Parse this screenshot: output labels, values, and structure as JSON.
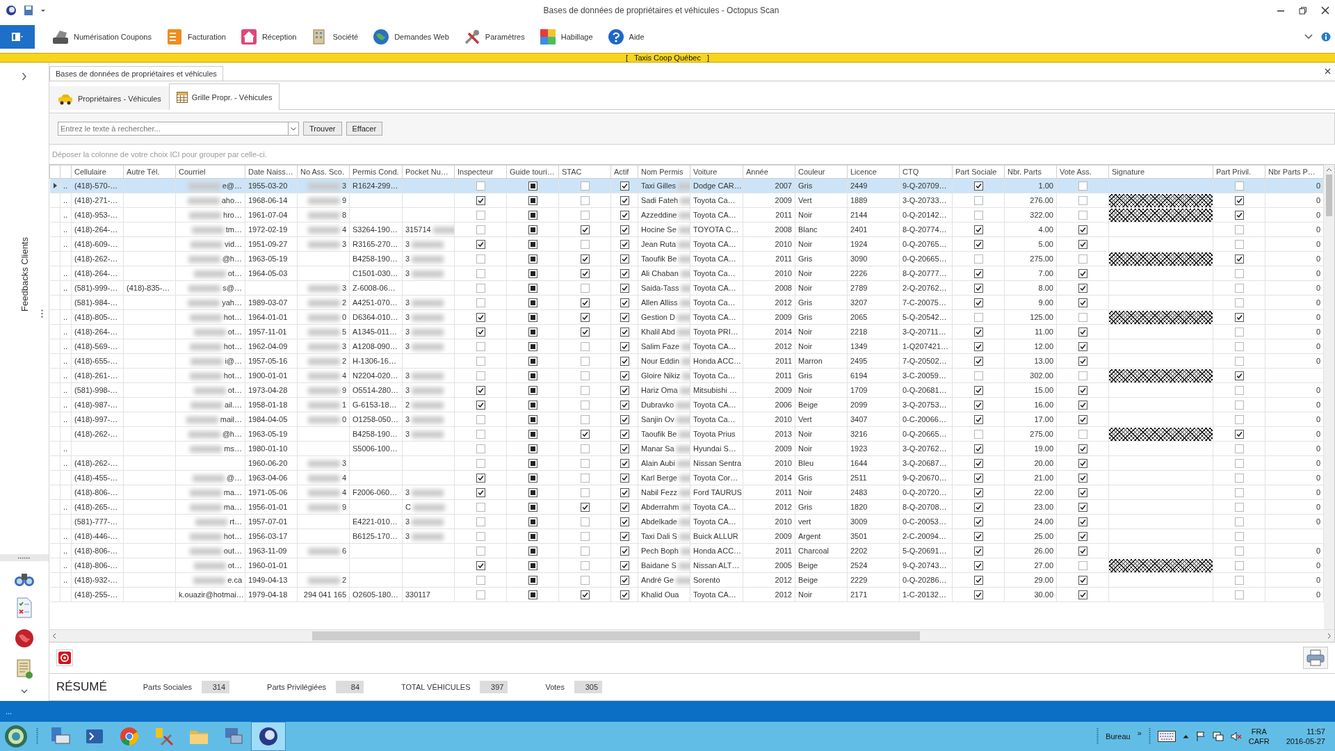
{
  "window": {
    "title": "Bases de données de propriétaires et véhicules - Octopus Scan"
  },
  "ribbon": {
    "items": [
      "Numérisation Coupons",
      "Facturation",
      "Réception",
      "Société",
      "Demandes Web",
      "Paramètres",
      "Habillage",
      "Aide"
    ]
  },
  "banner": "[   Taxis Coop Québec   ]",
  "sidebar": {
    "label": "Feedbacks Clients"
  },
  "document_tab": {
    "label": "Bases de données de propriétaires et véhicules"
  },
  "tabs": [
    {
      "label": "Propriétaires - Véhicules",
      "selected": false
    },
    {
      "label": "Grille Propr. - Véhicules",
      "selected": true
    }
  ],
  "search": {
    "placeholder": "Entrez le texte à rechercher...",
    "buttons": [
      "Trouver",
      "Effacer"
    ]
  },
  "group_hint": "Déposer la colonne de votre choix ICI pour grouper par celle-ci.",
  "grid": {
    "columns": [
      {
        "kind": "text"
      },
      {
        "label": "Cellulaire",
        "kind": "text"
      },
      {
        "label": "Autre Tél.",
        "kind": "text"
      },
      {
        "label": "Courriel",
        "kind": "blurstart"
      },
      {
        "label": "Date Naiss…",
        "kind": "text"
      },
      {
        "label": "No Ass. Sco.",
        "kind": "blurstart"
      },
      {
        "label": "Permis Cond.",
        "kind": "text"
      },
      {
        "label": "Pocket Nu…",
        "kind": "blurend"
      },
      {
        "label": "Inspecteur",
        "kind": "check"
      },
      {
        "label": "Guide touri…",
        "kind": "tristate"
      },
      {
        "label": "STAC",
        "kind": "check"
      },
      {
        "label": "Actif",
        "kind": "check"
      },
      {
        "label": "Nom Permis",
        "kind": "blurend"
      },
      {
        "label": "Voiture",
        "kind": "text"
      },
      {
        "label": "Année",
        "kind": "number"
      },
      {
        "label": "Couleur",
        "kind": "text"
      },
      {
        "label": "Licence",
        "kind": "text"
      },
      {
        "label": "CTQ",
        "kind": "text"
      },
      {
        "label": "Part Sociale",
        "kind": "check"
      },
      {
        "label": "Nbr. Parts",
        "kind": "number"
      },
      {
        "label": "Vote Ass.",
        "kind": "check"
      },
      {
        "label": "Signature",
        "kind": "signature"
      },
      {
        "label": "Part Privil.",
        "kind": "check"
      },
      {
        "label": "Nbr Parts P…",
        "kind": "number"
      }
    ],
    "rows": [
      {
        "selected": true,
        "redacted": true,
        "cells": [
          "..",
          "(418)-570-…",
          null,
          "e@…",
          "1955-03-20",
          "3",
          "R1624-299…",
          null,
          false,
          true,
          false,
          true,
          "Taxi Gilles",
          "Dodge CAR…",
          "2007",
          "Gris",
          "2449",
          "9-Q-20709…",
          true,
          "1.00",
          false,
          false,
          false,
          "0"
        ]
      },
      {
        "selected": false,
        "redacted": true,
        "cells": [
          "..",
          "(418)-271-…",
          null,
          "aho…",
          "1968-06-14",
          "9",
          null,
          null,
          true,
          true,
          false,
          true,
          "Sadi Fateh",
          "Toyota Ca…",
          "2009",
          "Vert",
          "1889",
          "3-Q-20733…",
          false,
          "276.00",
          false,
          true,
          true,
          "0"
        ]
      },
      {
        "selected": false,
        "redacted": true,
        "cells": [
          "..",
          "(418)-953-…",
          null,
          "hro…",
          "1961-07-04",
          "8",
          null,
          null,
          false,
          true,
          false,
          true,
          "Azzeddine",
          "Toyota CA…",
          "2011",
          "Noir",
          "2144",
          "0-Q-20142…",
          false,
          "322.00",
          false,
          true,
          true,
          "0"
        ]
      },
      {
        "selected": false,
        "redacted": true,
        "cells": [
          "..",
          "(418)-264-…",
          null,
          "tm…",
          "1972-02-19",
          "4",
          "S3264-190…",
          "315714",
          false,
          true,
          true,
          true,
          "Hocine Se",
          "TOYOTA C…",
          "2008",
          "Blanc",
          "2401",
          "8-Q-20774…",
          true,
          "4.00",
          true,
          false,
          false,
          "0"
        ]
      },
      {
        "selected": false,
        "redacted": true,
        "cells": [
          "..",
          "(418)-609-…",
          null,
          "vid…",
          "1951-09-27",
          "3",
          "R3165-270…",
          "3",
          true,
          true,
          false,
          true,
          "Jean Ruta",
          "Toyota CA…",
          "2010",
          "Noir",
          "1924",
          "0-Q-20765…",
          true,
          "5.00",
          true,
          false,
          false,
          "0"
        ]
      },
      {
        "selected": false,
        "redacted": true,
        "cells": [
          null,
          "(418)-262-…",
          null,
          "@h…",
          "1963-05-19",
          null,
          "B4258-190…",
          "3",
          false,
          true,
          true,
          true,
          "Taoufik Be",
          "Toyota CA…",
          "2011",
          "Gris",
          "3090",
          "0-Q-20665…",
          false,
          "275.00",
          false,
          true,
          true,
          "0"
        ]
      },
      {
        "selected": false,
        "redacted": true,
        "cells": [
          "..",
          "(418)-264-…",
          null,
          "ot…",
          "1964-05-03",
          null,
          "C1501-030…",
          "3",
          false,
          true,
          true,
          true,
          "Ali Chaban",
          "Toyota Ca…",
          "2010",
          "Noir",
          "2226",
          "8-Q-20777…",
          true,
          "7.00",
          true,
          false,
          false,
          "0"
        ]
      },
      {
        "selected": false,
        "redacted": true,
        "cells": [
          "..",
          "(581)-999-…",
          "(418)-835-…",
          "s@…",
          null,
          "3",
          "Z-6008-06…",
          null,
          false,
          true,
          false,
          true,
          "Saida-Tass",
          "Toyota CA…",
          "2008",
          "Noir",
          "2789",
          "2-Q-20762…",
          true,
          "8.00",
          true,
          false,
          false,
          "0"
        ]
      },
      {
        "selected": false,
        "redacted": true,
        "cells": [
          null,
          "(581)-984-…",
          null,
          "yah…",
          "1989-03-07",
          "2",
          "A4251-070…",
          "3",
          false,
          true,
          true,
          true,
          "Allen Alliss",
          "Toyota Ca…",
          "2012",
          "Gris",
          "3207",
          "7-C-20075…",
          true,
          "9.00",
          true,
          false,
          false,
          "0"
        ]
      },
      {
        "selected": false,
        "redacted": true,
        "cells": [
          "..",
          "(418)-805-…",
          null,
          "hot…",
          "1964-01-01",
          "0",
          "D6364-010…",
          "3",
          true,
          true,
          true,
          true,
          "Gestion D",
          "Toyota CA…",
          "2009",
          "Gris",
          "2065",
          "5-Q-20542…",
          false,
          "125.00",
          false,
          true,
          true,
          "0"
        ]
      },
      {
        "selected": false,
        "redacted": true,
        "cells": [
          "..",
          "(418)-264-…",
          null,
          "ot…",
          "1957-11-01",
          "5",
          "A1345-011…",
          "3",
          true,
          true,
          true,
          true,
          "Khalil Abd",
          "Toyota PRI…",
          "2014",
          "Noir",
          "2218",
          "3-Q-20711…",
          true,
          "11.00",
          true,
          false,
          false,
          "0"
        ]
      },
      {
        "selected": false,
        "redacted": true,
        "cells": [
          "..",
          "(418)-569-…",
          null,
          "hot…",
          "1962-04-09",
          "3",
          "A1208-090…",
          "3",
          false,
          true,
          false,
          true,
          "Salim Faze",
          "Toyota CA…",
          "2012",
          "Noir",
          "1349",
          "1-Q207421…",
          true,
          "12.00",
          true,
          false,
          false,
          "0"
        ]
      },
      {
        "selected": false,
        "redacted": true,
        "cells": [
          "..",
          "(418)-655-…",
          null,
          "i@…",
          "1957-05-16",
          "2",
          "H-1306-16…",
          null,
          false,
          true,
          false,
          true,
          "Nour Eddin",
          "Honda ACC…",
          "2011",
          "Marron",
          "2495",
          "7-Q-20502…",
          true,
          "13.00",
          true,
          false,
          false,
          "0"
        ]
      },
      {
        "selected": false,
        "redacted": true,
        "cells": [
          "..",
          "(418)-261-…",
          null,
          "hot…",
          "1900-01-01",
          "4",
          "N2204-020…",
          "3",
          false,
          true,
          false,
          true,
          "Gloire Nikiz",
          "Toyota Ca…",
          "2011",
          "Gris",
          "6194",
          "3-C-20059…",
          false,
          "302.00",
          false,
          true,
          true,
          null
        ]
      },
      {
        "selected": false,
        "redacted": true,
        "cells": [
          "..",
          "(581)-998-…",
          null,
          "ot…",
          "1973-04-28",
          "9",
          "O5514-280…",
          "3",
          true,
          true,
          false,
          true,
          "Hariz Oma",
          "Mitsubishi …",
          "2009",
          "Noir",
          "1709",
          "0-Q-20681…",
          true,
          "15.00",
          true,
          false,
          false,
          "0"
        ]
      },
      {
        "selected": false,
        "redacted": true,
        "cells": [
          "..",
          "(418)-987-…",
          null,
          "ail.…",
          "1958-01-18",
          "1",
          "G-6153-18…",
          "2",
          true,
          true,
          false,
          true,
          "Dubravko",
          "Toyota CA…",
          "2006",
          "Beige",
          "2099",
          "3-Q-20753…",
          true,
          "16.00",
          true,
          false,
          false,
          "0"
        ]
      },
      {
        "selected": false,
        "redacted": true,
        "cells": [
          "..",
          "(418)-997-…",
          null,
          "mail…",
          "1984-04-05",
          "0",
          "O1258-050…",
          "3",
          false,
          true,
          false,
          true,
          "Sanjin Ov",
          "Toyota Ca…",
          "2010",
          "Vert",
          "3407",
          "0-C-20066…",
          true,
          "17.00",
          true,
          false,
          false,
          "0"
        ]
      },
      {
        "selected": false,
        "redacted": true,
        "cells": [
          null,
          "(418)-262-…",
          null,
          "@h…",
          "1963-05-19",
          null,
          "B4258-190…",
          "3",
          false,
          true,
          true,
          true,
          "Taoufik Be",
          "Toyota Prius",
          "2013",
          "Noir",
          "3216",
          "0-Q-20665…",
          false,
          "275.00",
          false,
          true,
          true,
          "0"
        ]
      },
      {
        "selected": false,
        "redacted": true,
        "cells": [
          "..",
          null,
          null,
          "ms…",
          "1980-01-10",
          null,
          "S5006-100…",
          null,
          false,
          true,
          false,
          true,
          "Manar Sa",
          "Hyundai S…",
          "2009",
          "Noir",
          "1923",
          "3-Q-20762…",
          true,
          "19.00",
          true,
          false,
          false,
          "0"
        ]
      },
      {
        "selected": false,
        "redacted": true,
        "cells": [
          "..",
          "(418)-262-…",
          null,
          null,
          "1960-06-20",
          "3",
          null,
          null,
          false,
          true,
          false,
          true,
          "Alain Aubi",
          "Nissan Sentra",
          "2010",
          "Bleu",
          "1644",
          "3-Q-20687…",
          true,
          "20.00",
          true,
          false,
          false,
          "0"
        ]
      },
      {
        "selected": false,
        "redacted": true,
        "cells": [
          null,
          "(418)-455-…",
          null,
          "@…",
          "1963-04-06",
          "4",
          null,
          null,
          true,
          true,
          false,
          true,
          "Karl Berge",
          "Toyota Cor…",
          "2014",
          "Gris",
          "2511",
          "9-Q-20670…",
          true,
          "21.00",
          true,
          false,
          false,
          "0"
        ]
      },
      {
        "selected": false,
        "redacted": true,
        "cells": [
          null,
          "(418)-806-…",
          null,
          "ma…",
          "1971-05-06",
          "4",
          "F2006-060…",
          "3",
          true,
          true,
          false,
          true,
          "Nabil Fezz",
          "Ford TAURUS",
          "2011",
          "Noir",
          "2483",
          "0-Q-20720…",
          true,
          "22.00",
          true,
          false,
          false,
          "0"
        ]
      },
      {
        "selected": false,
        "redacted": true,
        "cells": [
          "..",
          "(418)-265-…",
          null,
          "ma…",
          "1956-01-01",
          "9",
          null,
          "C",
          false,
          true,
          true,
          true,
          "Abderrahm",
          "Toyota CA…",
          "2012",
          "Gris",
          "1820",
          "8-Q-20708…",
          true,
          "23.00",
          true,
          false,
          false,
          "0"
        ]
      },
      {
        "selected": false,
        "redacted": true,
        "cells": [
          null,
          "(581)-777-…",
          null,
          "rt…",
          "1957-07-01",
          null,
          "E4221-010…",
          "3",
          false,
          true,
          false,
          true,
          "Abdelkade",
          "Toyota CA…",
          "2010",
          "vert",
          "3009",
          "0-C-20053…",
          true,
          "24.00",
          true,
          false,
          false,
          "0"
        ]
      },
      {
        "selected": false,
        "redacted": true,
        "cells": [
          "..",
          "(418)-446-…",
          null,
          "hot…",
          "1956-03-17",
          null,
          "B6125-170…",
          "3",
          false,
          true,
          false,
          true,
          "Taxi Dali S",
          "Buick ALLUR",
          "2009",
          "Argent",
          "3501",
          "2-C-20094…",
          true,
          "25.00",
          true,
          false,
          false,
          null
        ]
      },
      {
        "selected": false,
        "redacted": true,
        "cells": [
          "..",
          "(418)-806-…",
          null,
          "out…",
          "1963-11-09",
          "6",
          null,
          null,
          false,
          true,
          false,
          true,
          "Pech Boph",
          "Honda ACC…",
          "2011",
          "Charcoal",
          "2202",
          "5-Q-20691…",
          true,
          "26.00",
          true,
          false,
          false,
          "0"
        ]
      },
      {
        "selected": false,
        "redacted": true,
        "cells": [
          "..",
          "(418)-806-…",
          null,
          "ot…",
          "1960-01-01",
          null,
          null,
          null,
          true,
          true,
          false,
          true,
          "Baidane S",
          "Nissan ALT…",
          "2005",
          "Beige",
          "2524",
          "9-Q-20743…",
          true,
          "27.00",
          false,
          true,
          false,
          "0"
        ]
      },
      {
        "selected": false,
        "redacted": true,
        "cells": [
          "..",
          "(418)-932-…",
          null,
          "e.ca",
          "1949-04-13",
          "2",
          null,
          null,
          false,
          true,
          false,
          true,
          "André Ge",
          "Sorento",
          "2012",
          "Beige",
          "2229",
          "0-Q-20286…",
          true,
          "29.00",
          true,
          false,
          false,
          "0"
        ]
      },
      {
        "selected": false,
        "redacted": false,
        "cells": [
          null,
          "(418)-255-…",
          null,
          "k.ouazir@hotmai…",
          "1979-04-18",
          "294 041 165",
          "O2605-180…",
          "330117",
          false,
          true,
          true,
          true,
          "Khalid Oua",
          "Toyota CA…",
          "2012",
          "Noir",
          "2171",
          "1-C-20132…",
          true,
          "30.00",
          true,
          false,
          false,
          "0"
        ]
      }
    ]
  },
  "summary": {
    "title": "RÉSUMÉ",
    "fields": [
      {
        "label": "Parts Sociales",
        "value": "314"
      },
      {
        "label": "Parts Privilégiées",
        "value": "84"
      },
      {
        "label": "TOTAL VÉHICULES",
        "value": "397"
      },
      {
        "label": "Votes",
        "value": "305"
      }
    ]
  },
  "status_bar": {
    "text": "..."
  },
  "taskbar": {
    "apps": [
      {
        "selected": false
      },
      {
        "selected": false
      },
      {
        "selected": false
      },
      {
        "selected": false
      },
      {
        "selected": false
      },
      {
        "selected": false
      },
      {
        "selected": true
      }
    ],
    "toolbar_label": "Bureau",
    "overflow": "»",
    "language": "FRA",
    "layout": "CAFR",
    "time": "11:57",
    "date": "2016-05-27"
  }
}
